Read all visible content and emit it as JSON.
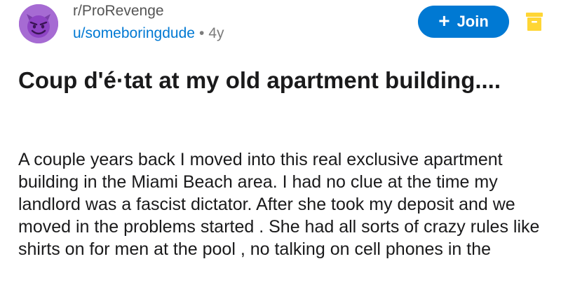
{
  "post": {
    "subreddit": "r/ProRevenge",
    "author": "u/someboringdude",
    "separator": "•",
    "age": "4y",
    "title": "Coup d'é·tat at my old apartment building....",
    "body": "A couple years back I moved into this real exclusive apartment building in the Miami Beach area. I had no clue at the time my landlord was a fascist dictator. After she took my deposit and we moved in the problems started . She had all sorts of crazy rules like shirts on for men at the pool , no talking on cell phones in the"
  },
  "actions": {
    "join_label": "Join",
    "join_icon": "plus-icon",
    "archive_icon": "archive-icon"
  },
  "colors": {
    "accent": "#0079d3",
    "avatar": "#a66bd3",
    "archive": "#ffd635"
  }
}
